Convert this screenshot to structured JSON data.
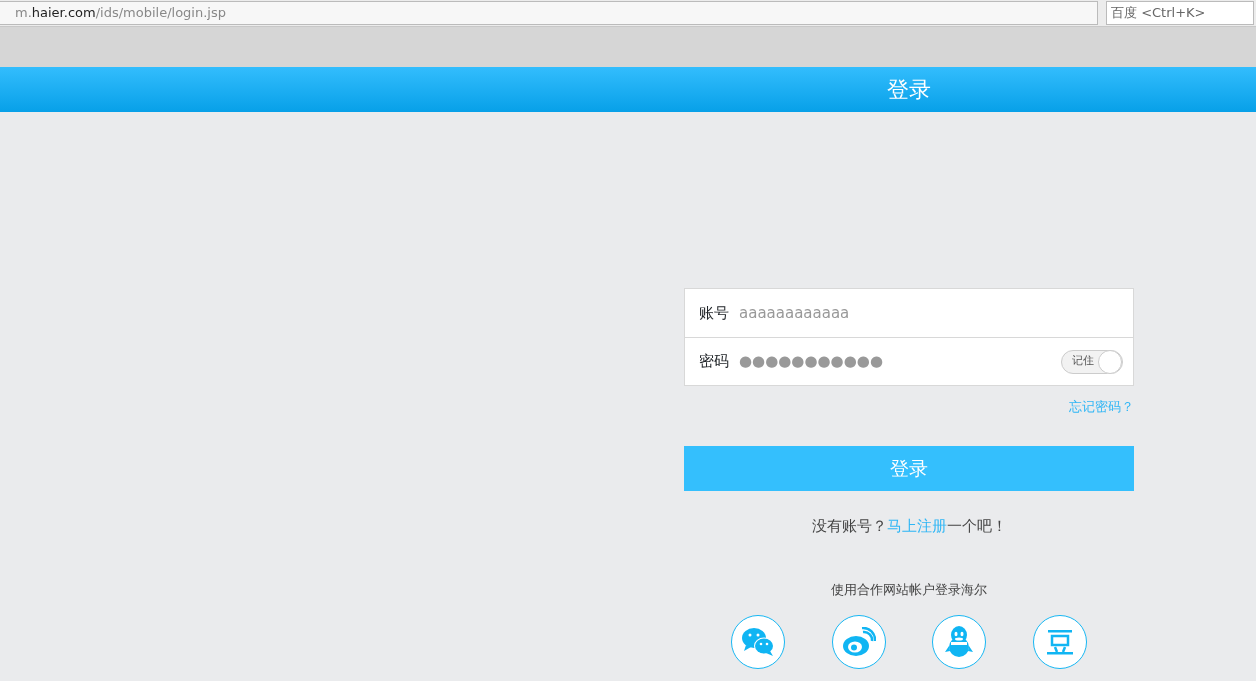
{
  "browser": {
    "url": "m.**haier.com**/ids/mobile/login.jsp",
    "search": {
      "placeholder": "百度 <Ctrl+K>"
    }
  },
  "header": {
    "title": "登录"
  },
  "form": {
    "account": {
      "label": "账号",
      "value": "aaaaaaaaaaaa"
    },
    "password": {
      "label": "密码",
      "value": "●●●●●●●●●●●"
    },
    "remember": {
      "label": "记住",
      "on": true
    },
    "forgot": "忘记密码？"
  },
  "submit": "登录",
  "register": {
    "before": "没有账号？",
    "link": "马上注册",
    "after": "一个吧！"
  },
  "partner_caption": "使用合作网站帐户登录海尔",
  "partners": [
    {
      "kind": "chat"
    },
    {
      "kind": "weibo"
    },
    {
      "kind": "qq"
    },
    {
      "kind": "douban"
    }
  ]
}
